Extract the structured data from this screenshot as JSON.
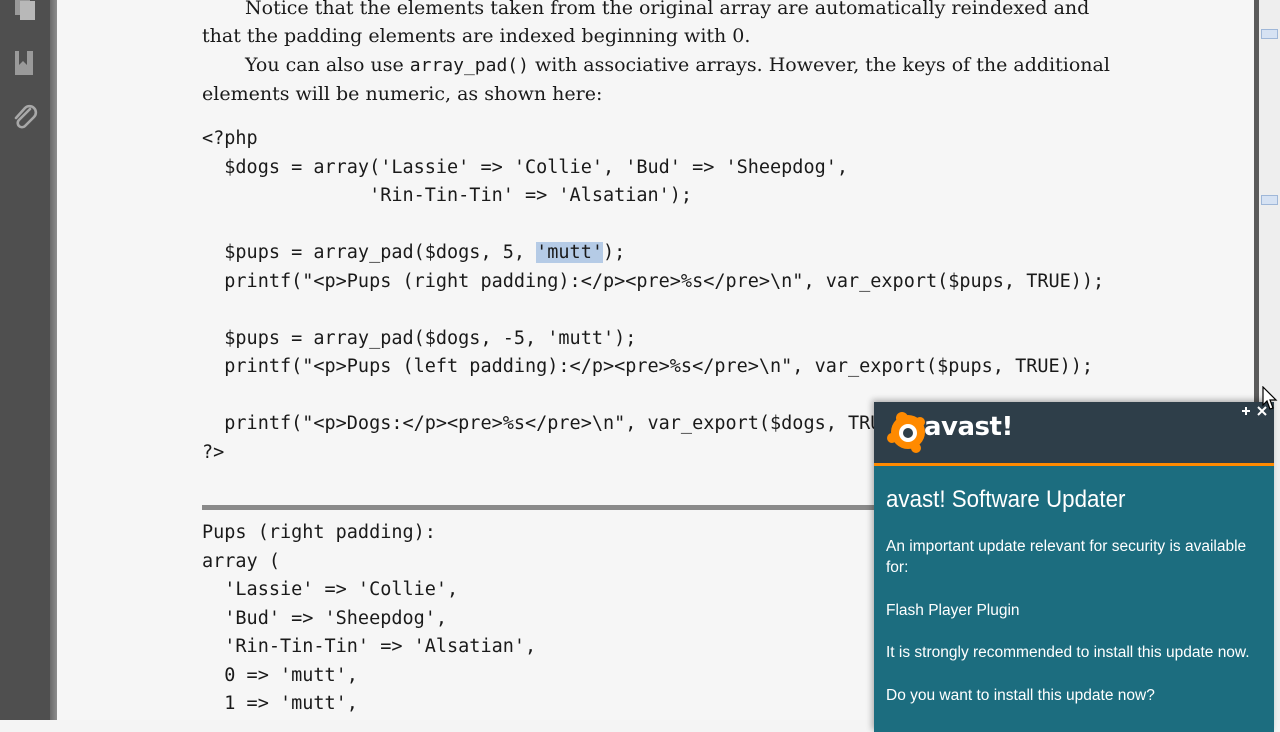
{
  "document": {
    "paragraphs": [
      {
        "lines": [
          "Notice that the elements taken from the original array are automatically reindexed and",
          "that the padding elements are indexed beginning with 0."
        ]
      },
      {
        "before": "You can also use ",
        "code": "array_pad()",
        "after": " with associative arrays. However, the keys of the additional",
        "line2": "elements will be numeric, as shown here:"
      }
    ],
    "code_block": {
      "line1": "<?php",
      "line2": "  $dogs = array('Lassie' => 'Collie', 'Bud' => 'Sheepdog',",
      "line3": "               'Rin-Tin-Tin' => 'Alsatian');",
      "line4": "",
      "line5_before": "  $pups = array_pad($dogs, 5, ",
      "line5_selected": "'mutt'",
      "line5_after": ");",
      "line6": "  printf(\"<p>Pups (right padding):</p><pre>%s</pre>\\n\", var_export($pups, TRUE));",
      "line7": "",
      "line8": "  $pups = array_pad($dogs, -5, 'mutt');",
      "line9": "  printf(\"<p>Pups (left padding):</p><pre>%s</pre>\\n\", var_export($pups, TRUE));",
      "line10": "",
      "line11": "  printf(\"<p>Dogs:</p><pre>%s</pre>\\n\", var_export($dogs, TRUE));",
      "line12": "?>"
    },
    "output_block": [
      "Pups (right padding):",
      "array (",
      "  'Lassie' => 'Collie',",
      "  'Bud' => 'Sheepdog',",
      "  'Rin-Tin-Tin' => 'Alsatian',",
      "  0 => 'mutt',",
      "  1 => 'mutt',"
    ]
  },
  "sidebar": {
    "icons": [
      "pages-icon",
      "bookmark-icon",
      "attachment-icon"
    ]
  },
  "avast_popup": {
    "logo_text": "avast!",
    "title": "avast! Software Updater",
    "message": "An important update relevant for security is available for:",
    "product": "Flash Player Plugin",
    "recommendation": "It is strongly recommended to install this update now.",
    "question": "Do you want to install this update now?"
  },
  "colors": {
    "popup_header": "#2e3e49",
    "popup_body": "#1c6d7f",
    "popup_accent": "#ff8a00",
    "selection": "#b5cbe6"
  }
}
